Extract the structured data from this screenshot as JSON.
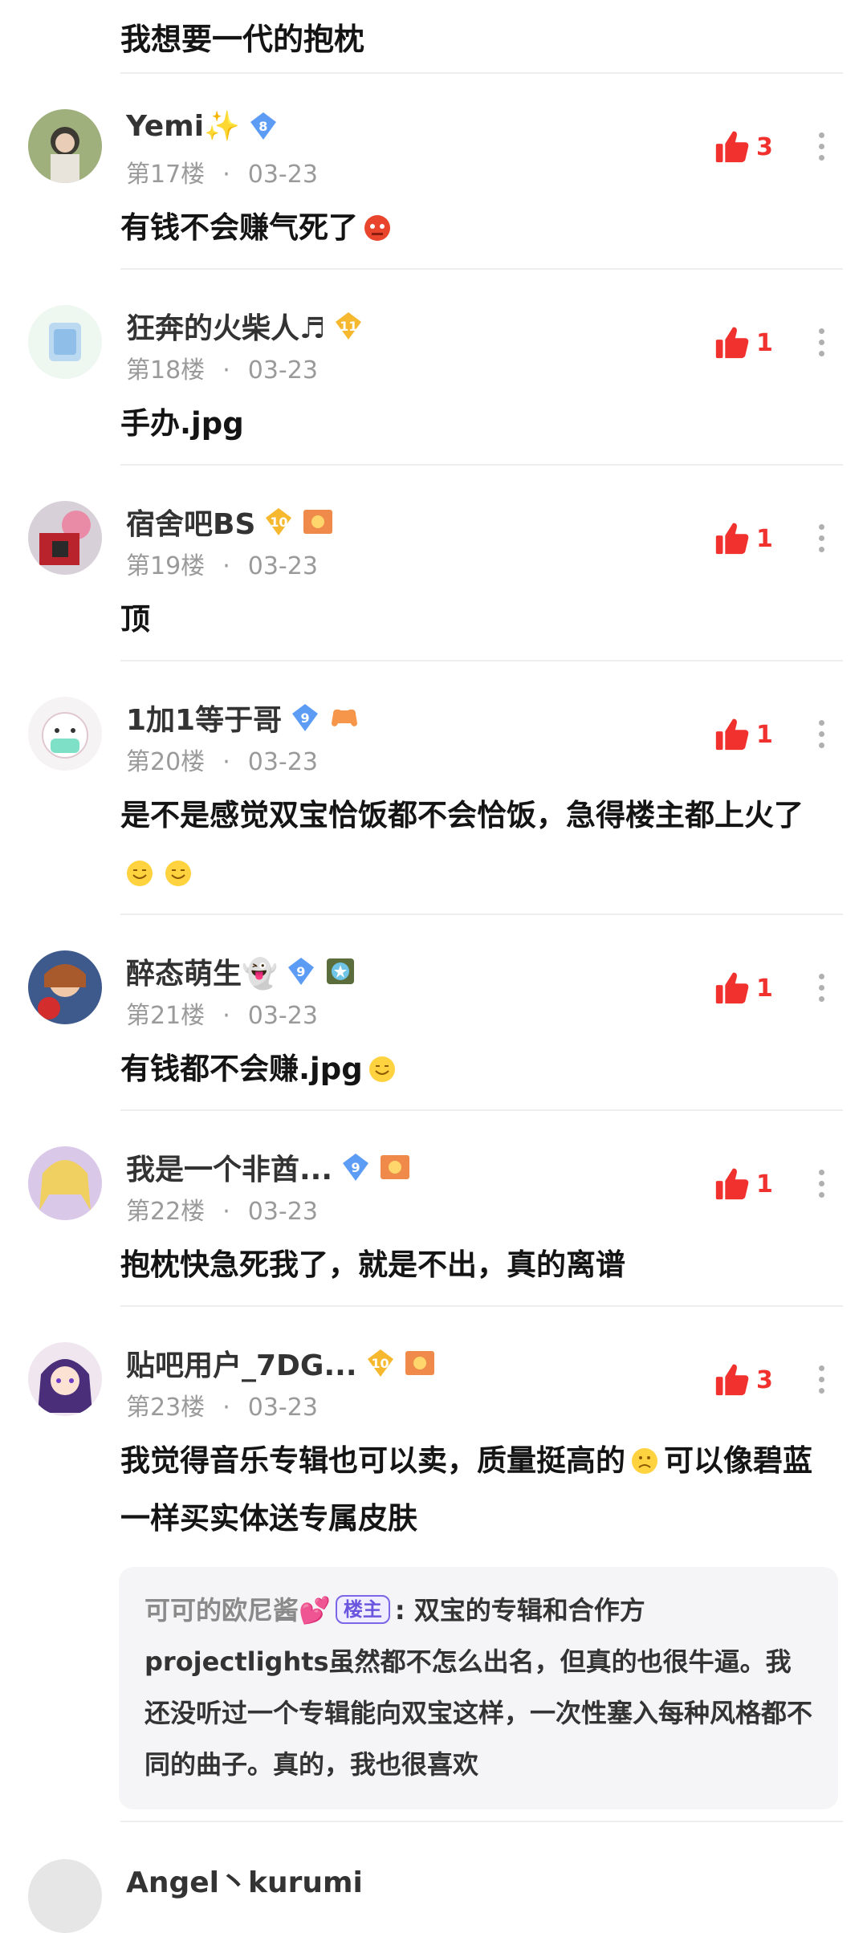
{
  "top_comment_tail": "我想要一代的抱枕",
  "icons": {
    "like": "thumbs-up-icon",
    "more": "more-vertical-icon",
    "level_badge": "diamond-level-badge-icon"
  },
  "colors": {
    "like_red": "#f0312d",
    "blue_badge": "#5c9cf5",
    "gold_badge": "#f5b82e",
    "host_tag": "#6a55df"
  },
  "comments": [
    {
      "username": "Yemi✨",
      "level": "8",
      "floor": "第17楼",
      "date": "03-23",
      "likes": "3",
      "text": "有钱不会赚气死了"
    },
    {
      "username": "狂奔的火柴人♬",
      "level": "11",
      "floor": "第18楼",
      "date": "03-23",
      "likes": "1",
      "text": "手办.jpg"
    },
    {
      "username": "宿舍吧BS",
      "level": "10",
      "floor": "第19楼",
      "date": "03-23",
      "likes": "1",
      "text": "顶"
    },
    {
      "username": "1加1等于哥",
      "level": "9",
      "floor": "第20楼",
      "date": "03-23",
      "likes": "1",
      "text": "是不是感觉双宝恰饭都不会恰饭，急得楼主都上火了"
    },
    {
      "username": "醉态萌生👻",
      "level": "9",
      "floor": "第21楼",
      "date": "03-23",
      "likes": "1",
      "text": "有钱都不会赚.jpg"
    },
    {
      "username": "我是一个非酋...",
      "level": "9",
      "floor": "第22楼",
      "date": "03-23",
      "likes": "1",
      "text": "抱枕快急死我了，就是不出，真的离谱"
    },
    {
      "username": "贴吧用户_7DG...",
      "level": "10",
      "floor": "第23楼",
      "date": "03-23",
      "likes": "3",
      "text_line1": "我觉得音乐专辑也可以卖，质量挺高的",
      "text_line1b": "可以像碧蓝",
      "text_line2": "一样买实体送专属皮肤",
      "reply": {
        "name": "可可的欧尼酱💕",
        "tag": "楼主",
        "content": "双宝的专辑和合作方projectlights虽然都不怎么出名，但真的也很牛逼。我还没听过一个专辑能向双宝这样，一次性塞入每种风格都不同的曲子。真的，我也很喜欢"
      }
    }
  ],
  "partial_next_username": "Angel丶kurumi"
}
